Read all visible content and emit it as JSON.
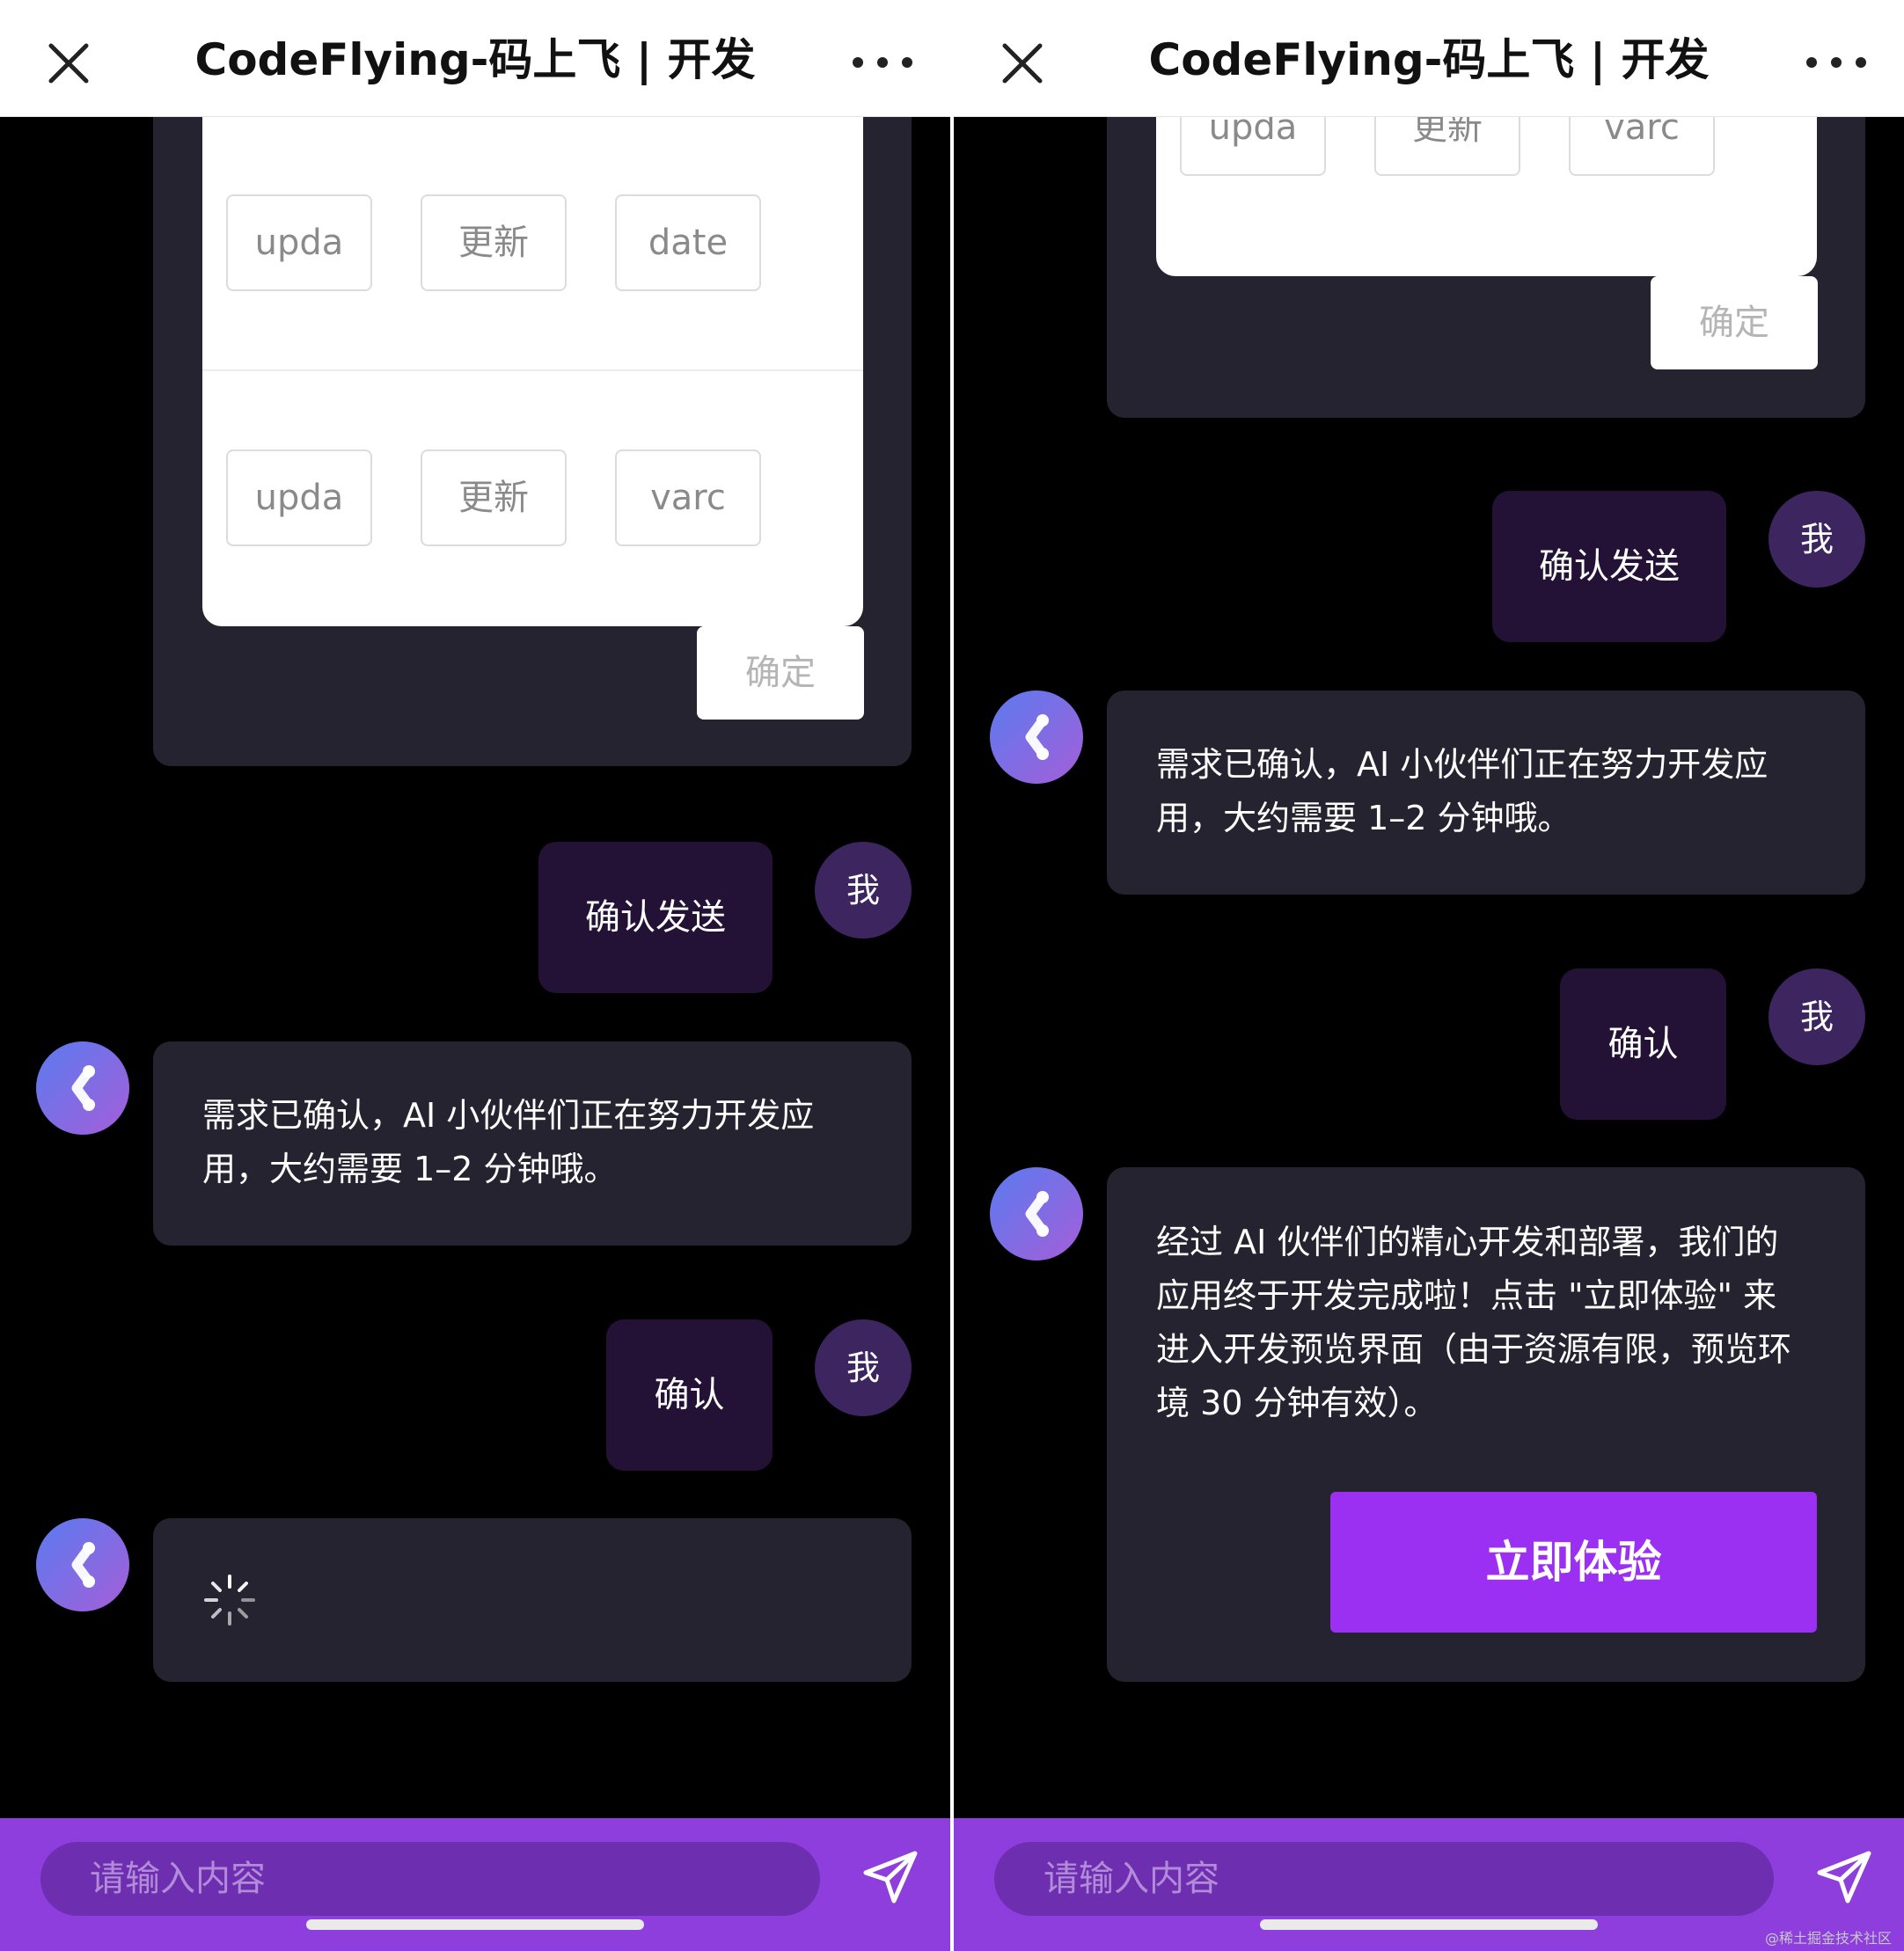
{
  "header": {
    "title": "CodeFlying-码上飞 | 开发",
    "close_icon": "close-icon",
    "more_icon": "more-icon"
  },
  "left": {
    "chips_row1": [
      "upda",
      "更新",
      "date"
    ],
    "chips_row2": [
      "upda",
      "更新",
      "varc"
    ],
    "confirm_label": "确定",
    "user_msg1": "确认发送",
    "user_avatar": "我",
    "bot_msg1_line1": "需求已确认，AI 小伙伴们正在努力开发应",
    "bot_msg1_line2": "用，大约需要 1–2 分钟哦。",
    "user_msg2": "确认",
    "loading_icon": "loading-spinner-icon"
  },
  "right": {
    "chips_row": [
      "upda",
      "更新",
      "varc"
    ],
    "confirm_label": "确定",
    "user_msg1": "确认发送",
    "user_avatar": "我",
    "bot_msg1_line1": "需求已确认，AI 小伙伴们正在努力开发应",
    "bot_msg1_line2": "用，大约需要 1–2 分钟哦。",
    "user_msg2": "确认",
    "bot_msg2_lines": [
      "经过 AI 伙伴们的精心开发和部署，我们的",
      "应用终于开发完成啦！点击 \"立即体验\" 来",
      "进入开发预览界面（由于资源有限，预览环",
      "境 30 分钟有效）。"
    ],
    "try_button": "立即体验"
  },
  "input": {
    "placeholder": "请输入内容",
    "send_icon": "send-icon"
  },
  "watermark": "@稀土掘金技术社区",
  "colors": {
    "header_bg": "#ffffff",
    "chat_bg": "#000000",
    "card_bg": "#24232f",
    "user_bubble_bg": "#231236",
    "user_avatar_bg": "#3d2560",
    "input_bar_bg": "#8d3edd",
    "input_field_bg": "#6d2eb0",
    "primary_button": "#9b2ff2"
  }
}
